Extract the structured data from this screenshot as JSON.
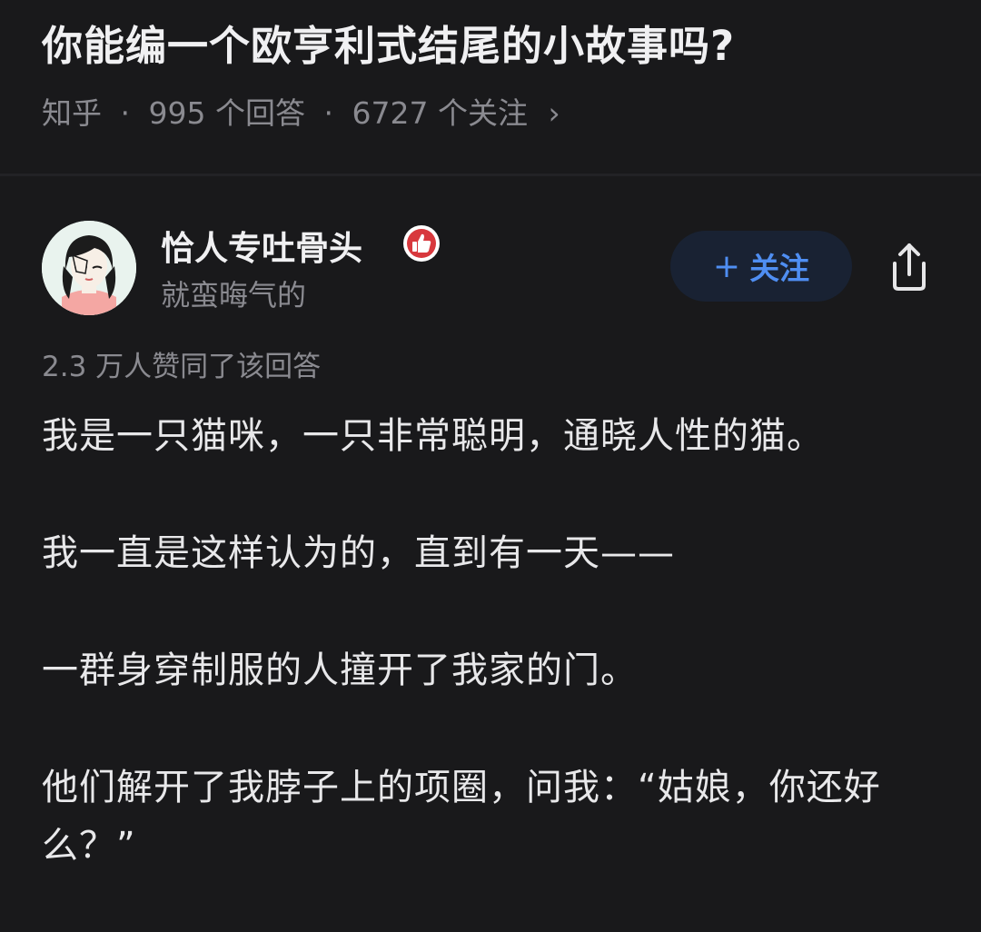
{
  "question": {
    "title": "你能编一个欧亨利式结尾的小故事吗?",
    "source": "知乎",
    "answers": "995 个回答",
    "followers": "6727 个关注",
    "chevron": "›"
  },
  "author": {
    "name": "恰人专吐骨头",
    "badge_icon": "thumbs-up-badge-icon",
    "bio": "就蛮晦气的",
    "avatar_icon": "avatar-illustration"
  },
  "actions": {
    "follow_plus": "+",
    "follow_label": "关注",
    "share_icon": "share-icon"
  },
  "answer": {
    "votes": "2.3 万人赞同了该回答",
    "paragraphs": [
      "我是一只猫咪，一只非常聪明，通晓人性的猫。",
      "我一直是这样认为的，直到有一天——",
      "一群身穿制服的人撞开了我家的门。",
      "他们解开了我脖子上的项圈，问我：“姑娘，你还好么？”"
    ]
  },
  "colors": {
    "background": "#19191b",
    "accent": "#4f8ef2",
    "follow_button_bg": "#192233",
    "badge_red": "#d8383d",
    "muted_text": "#8a8a90"
  }
}
